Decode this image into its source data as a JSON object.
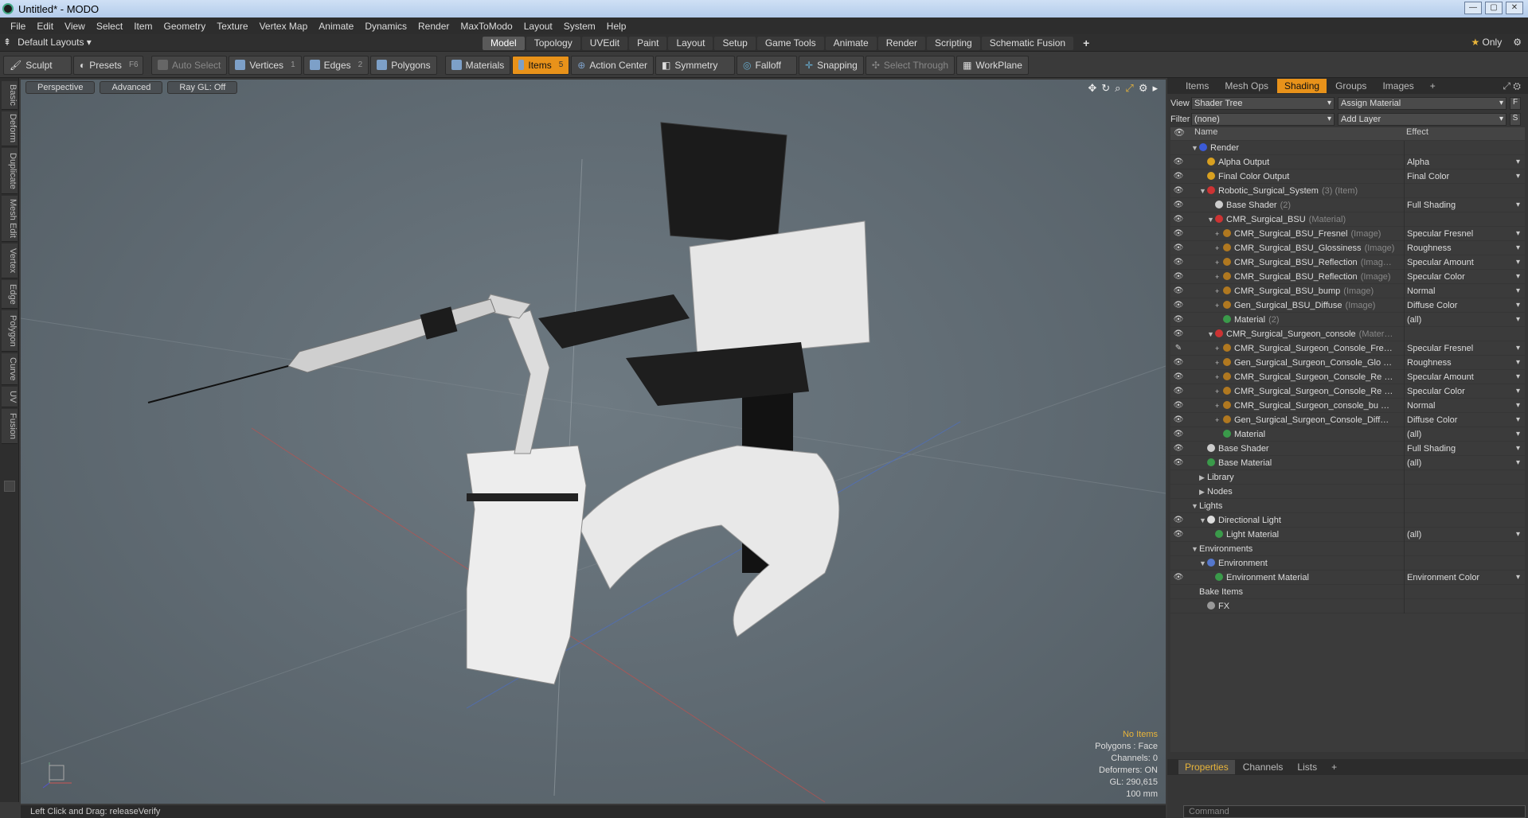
{
  "window": {
    "title": "Untitled* - MODO"
  },
  "menu": [
    "File",
    "Edit",
    "View",
    "Select",
    "Item",
    "Geometry",
    "Texture",
    "Vertex Map",
    "Animate",
    "Dynamics",
    "Render",
    "MaxToModo",
    "Layout",
    "System",
    "Help"
  ],
  "layout": {
    "preset": "Default Layouts",
    "tabs": [
      "Model",
      "Topology",
      "UVEdit",
      "Paint",
      "Layout",
      "Setup",
      "Game Tools",
      "Animate",
      "Render",
      "Scripting",
      "Schematic Fusion"
    ],
    "active_tab": "Model",
    "only_label": "Only"
  },
  "toolbar": {
    "sculpt": "Sculpt",
    "presets": "Presets",
    "presets_key": "F6",
    "auto_select": "Auto Select",
    "vertices": "Vertices",
    "vertices_num": "1",
    "edges": "Edges",
    "edges_num": "2",
    "polygons": "Polygons",
    "materials": "Materials",
    "items": "Items",
    "items_num": "5",
    "action_center": "Action Center",
    "symmetry": "Symmetry",
    "falloff": "Falloff",
    "snapping": "Snapping",
    "select_through": "Select Through",
    "workplane": "WorkPlane"
  },
  "left_tabs": [
    "Basic",
    "Deform",
    "Duplicate",
    "Mesh Edit",
    "Vertex",
    "Edge",
    "Polygon",
    "Curve",
    "UV",
    "Fusion"
  ],
  "viewport": {
    "view": "Perspective",
    "mode": "Advanced",
    "raygl": "Ray GL: Off",
    "info": {
      "items": "No Items",
      "polygons": "Polygons : Face",
      "channels": "Channels: 0",
      "deformers": "Deformers: ON",
      "gl": "GL: 290,615",
      "scale": "100 mm"
    }
  },
  "status": {
    "text": "Left Click and Drag:  releaseVerify"
  },
  "right_panel": {
    "tabs": [
      "Items",
      "Mesh Ops",
      "Shading",
      "Groups",
      "Images"
    ],
    "active_tab": "Shading",
    "view_label": "View",
    "view_value": "Shader Tree",
    "assign": "Assign Material",
    "filter_label": "Filter",
    "filter_value": "(none)",
    "add_layer": "Add Layer",
    "col_name": "Name",
    "col_effect": "Effect",
    "rows": [
      {
        "indent": 0,
        "twirl": "▼",
        "eye": "",
        "dot": "#3b5bd8",
        "name": "Render",
        "tag": "",
        "effect": ""
      },
      {
        "indent": 1,
        "twirl": "",
        "eye": "👁",
        "dot": "#d8a020",
        "name": "Alpha Output",
        "tag": "",
        "effect": "Alpha"
      },
      {
        "indent": 1,
        "twirl": "",
        "eye": "👁",
        "dot": "#d8a020",
        "name": "Final Color Output",
        "tag": "",
        "effect": "Final Color"
      },
      {
        "indent": 1,
        "twirl": "▼",
        "eye": "👁",
        "dot": "#c33",
        "name": "Robotic_Surgical_System",
        "tag": "(3) (Item)",
        "effect": ""
      },
      {
        "indent": 2,
        "twirl": "",
        "eye": "👁",
        "dot": "#ccc",
        "name": "Base Shader",
        "tag": "(2)",
        "effect": "Full Shading"
      },
      {
        "indent": 2,
        "twirl": "▼",
        "eye": "👁",
        "dot": "#c33",
        "name": "CMR_Surgical_BSU",
        "tag": "(Material)",
        "effect": ""
      },
      {
        "indent": 3,
        "twirl": "+",
        "eye": "👁",
        "dot": "#b07820",
        "name": "CMR_Surgical_BSU_Fresnel",
        "tag": "(Image)",
        "effect": "Specular Fresnel"
      },
      {
        "indent": 3,
        "twirl": "+",
        "eye": "👁",
        "dot": "#b07820",
        "name": "CMR_Surgical_BSU_Glossiness",
        "tag": "(Image)",
        "effect": "Roughness"
      },
      {
        "indent": 3,
        "twirl": "+",
        "eye": "👁",
        "dot": "#b07820",
        "name": "CMR_Surgical_BSU_Reflection",
        "tag": "(Imag…",
        "effect": "Specular Amount"
      },
      {
        "indent": 3,
        "twirl": "+",
        "eye": "👁",
        "dot": "#b07820",
        "name": "CMR_Surgical_BSU_Reflection",
        "tag": "(Image)",
        "effect": "Specular Color"
      },
      {
        "indent": 3,
        "twirl": "+",
        "eye": "👁",
        "dot": "#b07820",
        "name": "CMR_Surgical_BSU_bump",
        "tag": "(Image)",
        "effect": "Normal"
      },
      {
        "indent": 3,
        "twirl": "+",
        "eye": "👁",
        "dot": "#b07820",
        "name": "Gen_Surgical_BSU_Diffuse",
        "tag": "(Image)",
        "effect": "Diffuse Color"
      },
      {
        "indent": 3,
        "twirl": "",
        "eye": "👁",
        "dot": "#3a9a4a",
        "name": "Material",
        "tag": "(2)",
        "effect": "(all)"
      },
      {
        "indent": 2,
        "twirl": "▼",
        "eye": "👁",
        "dot": "#c33",
        "name": "CMR_Surgical_Surgeon_console",
        "tag": "(Mater…",
        "effect": ""
      },
      {
        "indent": 3,
        "twirl": "+",
        "eye": "✎",
        "dot": "#b07820",
        "name": "CMR_Surgical_Surgeon_Console_Fre…",
        "tag": "",
        "effect": "Specular Fresnel"
      },
      {
        "indent": 3,
        "twirl": "+",
        "eye": "👁",
        "dot": "#b07820",
        "name": "Gen_Surgical_Surgeon_Console_Glo …",
        "tag": "",
        "effect": "Roughness"
      },
      {
        "indent": 3,
        "twirl": "+",
        "eye": "👁",
        "dot": "#b07820",
        "name": "CMR_Surgical_Surgeon_Console_Re …",
        "tag": "",
        "effect": "Specular Amount"
      },
      {
        "indent": 3,
        "twirl": "+",
        "eye": "👁",
        "dot": "#b07820",
        "name": "CMR_Surgical_Surgeon_Console_Re …",
        "tag": "",
        "effect": "Specular Color"
      },
      {
        "indent": 3,
        "twirl": "+",
        "eye": "👁",
        "dot": "#b07820",
        "name": "CMR_Surgical_Surgeon_console_bu …",
        "tag": "",
        "effect": "Normal"
      },
      {
        "indent": 3,
        "twirl": "+",
        "eye": "👁",
        "dot": "#b07820",
        "name": "Gen_Surgical_Surgeon_Console_Diff…",
        "tag": "",
        "effect": "Diffuse Color"
      },
      {
        "indent": 3,
        "twirl": "",
        "eye": "👁",
        "dot": "#3a9a4a",
        "name": "Material",
        "tag": "",
        "effect": "(all)"
      },
      {
        "indent": 1,
        "twirl": "",
        "eye": "👁",
        "dot": "#ccc",
        "name": "Base Shader",
        "tag": "",
        "effect": "Full Shading"
      },
      {
        "indent": 1,
        "twirl": "",
        "eye": "👁",
        "dot": "#3a9a4a",
        "name": "Base Material",
        "tag": "",
        "effect": "(all)"
      },
      {
        "indent": 1,
        "twirl": "▶",
        "eye": "",
        "dot": "",
        "name": "Library",
        "tag": "",
        "effect": ""
      },
      {
        "indent": 1,
        "twirl": "▶",
        "eye": "",
        "dot": "",
        "name": "Nodes",
        "tag": "",
        "effect": ""
      },
      {
        "indent": 0,
        "twirl": "▼",
        "eye": "",
        "dot": "",
        "name": "Lights",
        "tag": "",
        "effect": ""
      },
      {
        "indent": 1,
        "twirl": "▼",
        "eye": "👁",
        "dot": "#ddd",
        "name": "Directional Light",
        "tag": "",
        "effect": ""
      },
      {
        "indent": 2,
        "twirl": "",
        "eye": "👁",
        "dot": "#3a9a4a",
        "name": "Light Material",
        "tag": "",
        "effect": "(all)"
      },
      {
        "indent": 0,
        "twirl": "▼",
        "eye": "",
        "dot": "",
        "name": "Environments",
        "tag": "",
        "effect": ""
      },
      {
        "indent": 1,
        "twirl": "▼",
        "eye": "",
        "dot": "#5577cc",
        "name": "Environment",
        "tag": "",
        "effect": ""
      },
      {
        "indent": 2,
        "twirl": "",
        "eye": "👁",
        "dot": "#3a9a4a",
        "name": "Environment Material",
        "tag": "",
        "effect": "Environment Color"
      },
      {
        "indent": 0,
        "twirl": "",
        "eye": "",
        "dot": "",
        "name": "Bake Items",
        "tag": "",
        "effect": ""
      },
      {
        "indent": 1,
        "twirl": "",
        "eye": "",
        "dot": "#999",
        "name": "FX",
        "tag": "",
        "effect": ""
      }
    ],
    "props_tabs": [
      "Properties",
      "Channels",
      "Lists"
    ],
    "props_active": "Properties",
    "command_placeholder": "Command"
  }
}
